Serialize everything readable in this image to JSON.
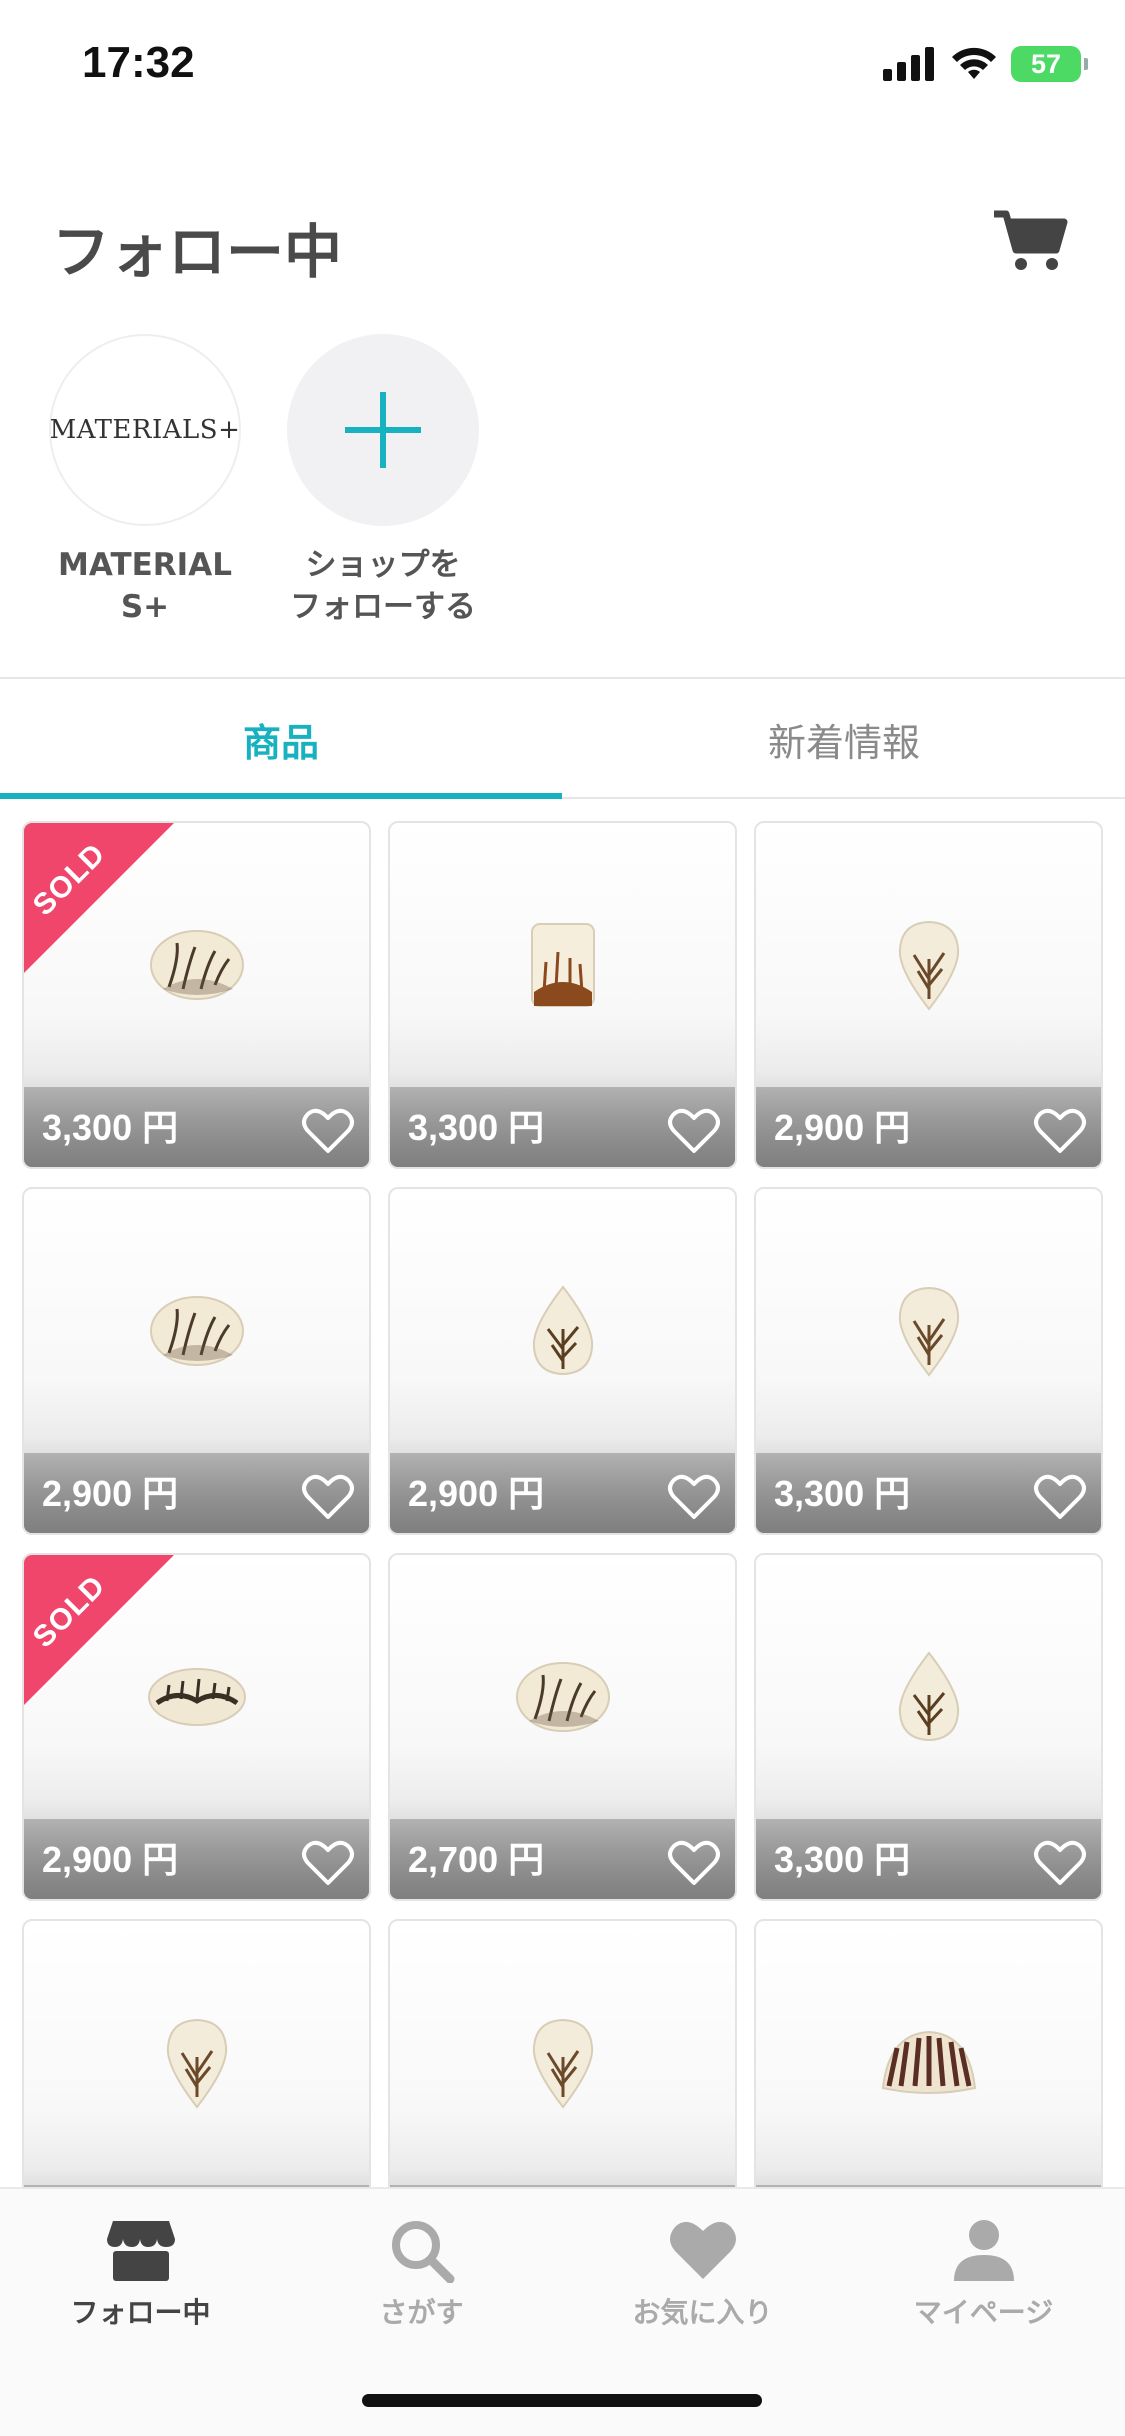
{
  "status_bar": {
    "time": "17:32",
    "battery": "57"
  },
  "header": {
    "title": "フォロー中"
  },
  "shops": [
    {
      "label": "MATERIAL\nS+",
      "logo_text": "MATERIALS+"
    },
    {
      "label": "ショップを\nフォローする"
    }
  ],
  "tabs": [
    {
      "label": "商品",
      "active": true
    },
    {
      "label": "新着情報",
      "active": false
    }
  ],
  "products": [
    {
      "price": "3,300 円",
      "sold": true,
      "shape": "oval"
    },
    {
      "price": "3,300 円",
      "sold": false,
      "shape": "rect"
    },
    {
      "price": "2,900 円",
      "sold": false,
      "shape": "drop-down"
    },
    {
      "price": "2,900 円",
      "sold": false,
      "shape": "oval"
    },
    {
      "price": "2,900 円",
      "sold": false,
      "shape": "drop-up"
    },
    {
      "price": "3,300 円",
      "sold": false,
      "shape": "drop-down"
    },
    {
      "price": "2,900 円",
      "sold": true,
      "shape": "oval-wide"
    },
    {
      "price": "2,700 円",
      "sold": false,
      "shape": "oval"
    },
    {
      "price": "3,300 円",
      "sold": false,
      "shape": "drop-up"
    },
    {
      "price": "",
      "sold": false,
      "shape": "drop-down"
    },
    {
      "price": "",
      "sold": false,
      "shape": "drop-down"
    },
    {
      "price": "",
      "sold": false,
      "shape": "fan"
    }
  ],
  "sold_label": "SOLD",
  "bottom_nav": [
    {
      "label": "フォロー中",
      "icon": "shop-icon",
      "active": true
    },
    {
      "label": "さがす",
      "icon": "search-icon",
      "active": false
    },
    {
      "label": "お気に入り",
      "icon": "heart-icon",
      "active": false
    },
    {
      "label": "マイページ",
      "icon": "person-icon",
      "active": false
    }
  ],
  "colors": {
    "accent": "#17b1c0",
    "sold": "#f0466c",
    "battery": "#4cd964"
  }
}
